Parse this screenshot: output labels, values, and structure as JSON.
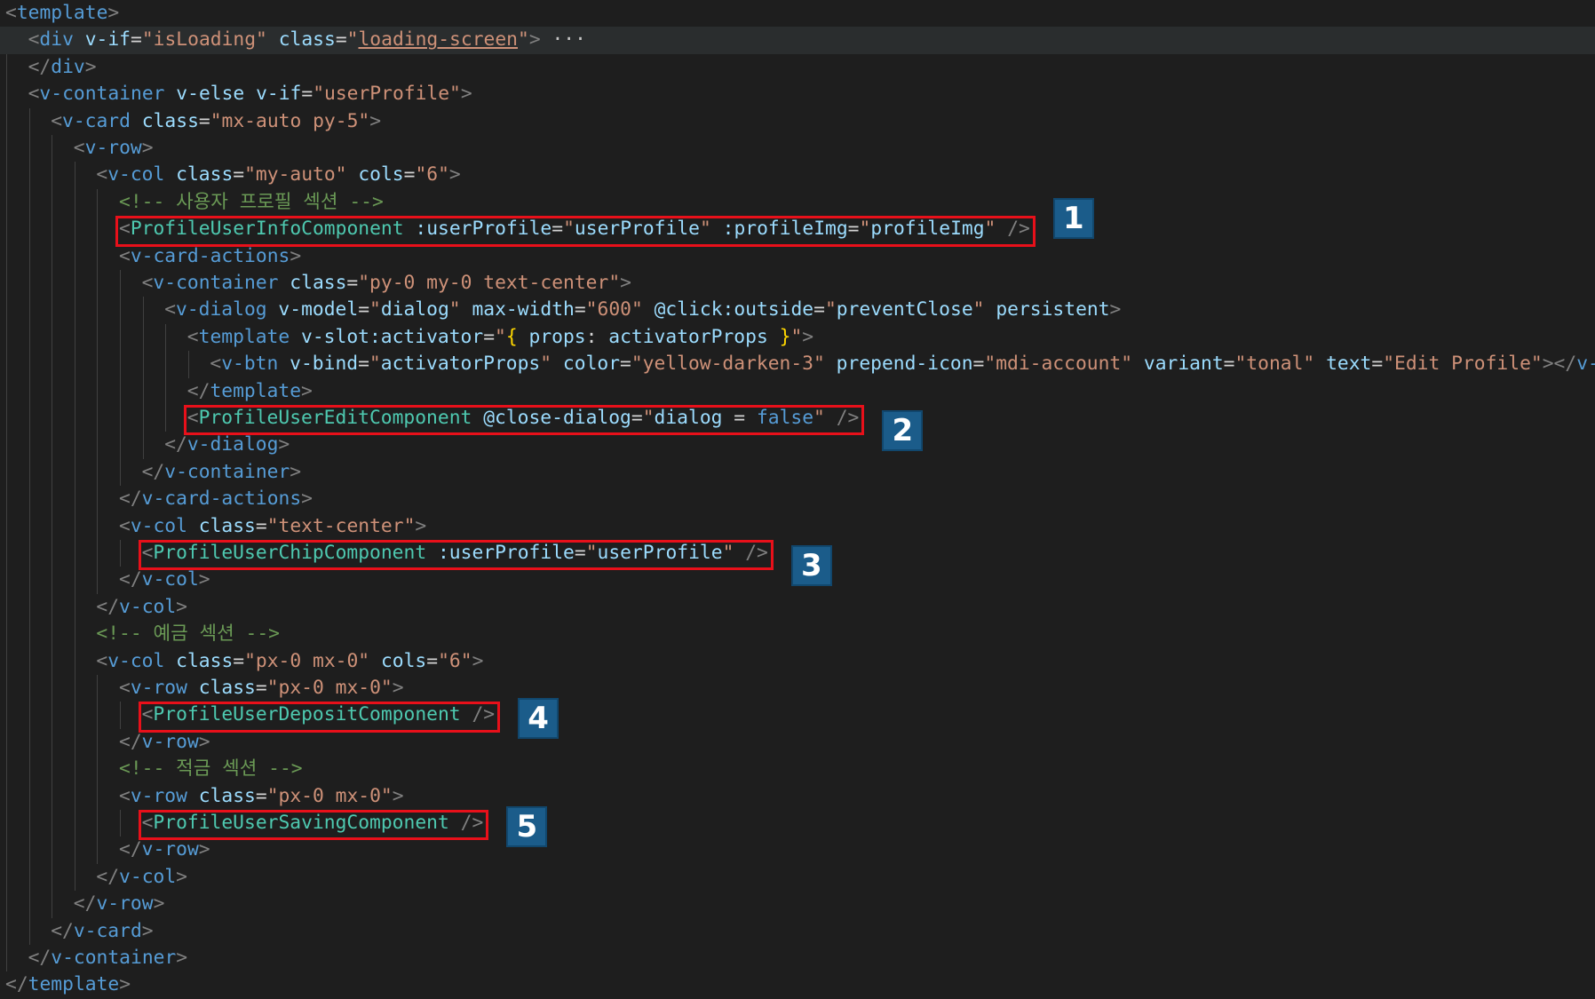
{
  "editor": {
    "theme_colors": {
      "background": "#1e1e1e",
      "tag": "#569cd6",
      "component": "#4ec9b0",
      "attribute": "#9cdcfe",
      "string": "#ce9178",
      "comment": "#6a9955",
      "punctuation": "#808080",
      "highlight_box": "#e8101a",
      "badge": "#1b5c8a"
    },
    "lines": [
      {
        "indent": 0,
        "tokens": [
          [
            "punc",
            "<"
          ],
          [
            "tag",
            "template"
          ],
          [
            "punc",
            ">"
          ]
        ]
      },
      {
        "indent": 1,
        "highlight": true,
        "tokens": [
          [
            "punc",
            "<"
          ],
          [
            "tag",
            "div"
          ],
          [
            "plain",
            " "
          ],
          [
            "attr",
            "v-if"
          ],
          [
            "eq",
            "="
          ],
          [
            "str",
            "\"isLoading\""
          ],
          [
            "plain",
            " "
          ],
          [
            "attr",
            "class"
          ],
          [
            "eq",
            "="
          ],
          [
            "str",
            "\""
          ],
          [
            "stru",
            "loading-screen"
          ],
          [
            "str",
            "\""
          ],
          [
            "punc",
            ">"
          ],
          [
            "fold",
            " ···"
          ]
        ]
      },
      {
        "indent": 1,
        "tokens": [
          [
            "punc",
            "</"
          ],
          [
            "tag",
            "div"
          ],
          [
            "punc",
            ">"
          ]
        ]
      },
      {
        "indent": 1,
        "tokens": [
          [
            "punc",
            "<"
          ],
          [
            "tag",
            "v-container"
          ],
          [
            "plain",
            " "
          ],
          [
            "attr",
            "v-else"
          ],
          [
            "plain",
            " "
          ],
          [
            "attr",
            "v-if"
          ],
          [
            "eq",
            "="
          ],
          [
            "str",
            "\"userProfile\""
          ],
          [
            "punc",
            ">"
          ]
        ]
      },
      {
        "indent": 2,
        "tokens": [
          [
            "punc",
            "<"
          ],
          [
            "tag",
            "v-card"
          ],
          [
            "plain",
            " "
          ],
          [
            "attr",
            "class"
          ],
          [
            "eq",
            "="
          ],
          [
            "str",
            "\"mx-auto py-5\""
          ],
          [
            "punc",
            ">"
          ]
        ]
      },
      {
        "indent": 3,
        "tokens": [
          [
            "punc",
            "<"
          ],
          [
            "tag",
            "v-row"
          ],
          [
            "punc",
            ">"
          ]
        ]
      },
      {
        "indent": 4,
        "tokens": [
          [
            "punc",
            "<"
          ],
          [
            "tag",
            "v-col"
          ],
          [
            "plain",
            " "
          ],
          [
            "attr",
            "class"
          ],
          [
            "eq",
            "="
          ],
          [
            "str",
            "\"my-auto\""
          ],
          [
            "plain",
            " "
          ],
          [
            "attr",
            "cols"
          ],
          [
            "eq",
            "="
          ],
          [
            "str",
            "\"6\""
          ],
          [
            "punc",
            ">"
          ]
        ]
      },
      {
        "indent": 5,
        "tokens": [
          [
            "comment",
            "<!-- 사용자 프로필 섹션 -->"
          ]
        ]
      },
      {
        "indent": 5,
        "tokens": [
          [
            "punc",
            "<"
          ],
          [
            "comp",
            "ProfileUserInfoComponent"
          ],
          [
            "plain",
            " "
          ],
          [
            "attr",
            ":userProfile"
          ],
          [
            "eq",
            "="
          ],
          [
            "str",
            "\""
          ],
          [
            "attr",
            "userProfile"
          ],
          [
            "str",
            "\""
          ],
          [
            "plain",
            " "
          ],
          [
            "attr",
            ":profileImg"
          ],
          [
            "eq",
            "="
          ],
          [
            "str",
            "\""
          ],
          [
            "attr",
            "profileImg"
          ],
          [
            "str",
            "\""
          ],
          [
            "plain",
            " "
          ],
          [
            "punc",
            "/>"
          ]
        ]
      },
      {
        "indent": 5,
        "tokens": [
          [
            "punc",
            "<"
          ],
          [
            "tag",
            "v-card-actions"
          ],
          [
            "punc",
            ">"
          ]
        ]
      },
      {
        "indent": 6,
        "tokens": [
          [
            "punc",
            "<"
          ],
          [
            "tag",
            "v-container"
          ],
          [
            "plain",
            " "
          ],
          [
            "attr",
            "class"
          ],
          [
            "eq",
            "="
          ],
          [
            "str",
            "\"py-0 my-0 text-center\""
          ],
          [
            "punc",
            ">"
          ]
        ]
      },
      {
        "indent": 7,
        "tokens": [
          [
            "punc",
            "<"
          ],
          [
            "tag",
            "v-dialog"
          ],
          [
            "plain",
            " "
          ],
          [
            "attr",
            "v-model"
          ],
          [
            "eq",
            "="
          ],
          [
            "str",
            "\""
          ],
          [
            "attr",
            "dialog"
          ],
          [
            "str",
            "\""
          ],
          [
            "plain",
            " "
          ],
          [
            "attr",
            "max-width"
          ],
          [
            "eq",
            "="
          ],
          [
            "str",
            "\"600\""
          ],
          [
            "plain",
            " "
          ],
          [
            "attr",
            "@click:outside"
          ],
          [
            "eq",
            "="
          ],
          [
            "str",
            "\""
          ],
          [
            "attr",
            "preventClose"
          ],
          [
            "str",
            "\""
          ],
          [
            "plain",
            " "
          ],
          [
            "attr",
            "persistent"
          ],
          [
            "punc",
            ">"
          ]
        ]
      },
      {
        "indent": 8,
        "tokens": [
          [
            "punc",
            "<"
          ],
          [
            "tag",
            "template"
          ],
          [
            "plain",
            " "
          ],
          [
            "attr",
            "v-slot:activator"
          ],
          [
            "eq",
            "="
          ],
          [
            "str",
            "\""
          ],
          [
            "brace",
            "{"
          ],
          [
            "plain",
            " "
          ],
          [
            "attr",
            "props"
          ],
          [
            "plain",
            ": "
          ],
          [
            "attr",
            "activatorProps"
          ],
          [
            "plain",
            " "
          ],
          [
            "brace",
            "}"
          ],
          [
            "str",
            "\""
          ],
          [
            "punc",
            ">"
          ]
        ]
      },
      {
        "indent": 9,
        "tokens": [
          [
            "punc",
            "<"
          ],
          [
            "tag",
            "v-btn"
          ],
          [
            "plain",
            " "
          ],
          [
            "attr",
            "v-bind"
          ],
          [
            "eq",
            "="
          ],
          [
            "str",
            "\""
          ],
          [
            "attr",
            "activatorProps"
          ],
          [
            "str",
            "\""
          ],
          [
            "plain",
            " "
          ],
          [
            "attr",
            "color"
          ],
          [
            "eq",
            "="
          ],
          [
            "str",
            "\"yellow-darken-3\""
          ],
          [
            "plain",
            " "
          ],
          [
            "attr",
            "prepend-icon"
          ],
          [
            "eq",
            "="
          ],
          [
            "str",
            "\"mdi-account\""
          ],
          [
            "plain",
            " "
          ],
          [
            "attr",
            "variant"
          ],
          [
            "eq",
            "="
          ],
          [
            "str",
            "\"tonal\""
          ],
          [
            "plain",
            " "
          ],
          [
            "attr",
            "text"
          ],
          [
            "eq",
            "="
          ],
          [
            "str",
            "\"Edit Profile\""
          ],
          [
            "punc",
            "></"
          ],
          [
            "tag",
            "v-btn"
          ],
          [
            "punc",
            ">"
          ]
        ]
      },
      {
        "indent": 8,
        "tokens": [
          [
            "punc",
            "</"
          ],
          [
            "tag",
            "template"
          ],
          [
            "punc",
            ">"
          ]
        ]
      },
      {
        "indent": 8,
        "tokens": [
          [
            "punc",
            "<"
          ],
          [
            "comp",
            "ProfileUserEditComponent"
          ],
          [
            "plain",
            " "
          ],
          [
            "attr",
            "@close-dialog"
          ],
          [
            "eq",
            "="
          ],
          [
            "str",
            "\""
          ],
          [
            "attr",
            "dialog"
          ],
          [
            "plain",
            " = "
          ],
          [
            "kw",
            "false"
          ],
          [
            "str",
            "\""
          ],
          [
            "plain",
            " "
          ],
          [
            "punc",
            "/>"
          ]
        ]
      },
      {
        "indent": 7,
        "tokens": [
          [
            "punc",
            "</"
          ],
          [
            "tag",
            "v-dialog"
          ],
          [
            "punc",
            ">"
          ]
        ]
      },
      {
        "indent": 6,
        "tokens": [
          [
            "punc",
            "</"
          ],
          [
            "tag",
            "v-container"
          ],
          [
            "punc",
            ">"
          ]
        ]
      },
      {
        "indent": 5,
        "tokens": [
          [
            "punc",
            "</"
          ],
          [
            "tag",
            "v-card-actions"
          ],
          [
            "punc",
            ">"
          ]
        ]
      },
      {
        "indent": 5,
        "tokens": [
          [
            "punc",
            "<"
          ],
          [
            "tag",
            "v-col"
          ],
          [
            "plain",
            " "
          ],
          [
            "attr",
            "class"
          ],
          [
            "eq",
            "="
          ],
          [
            "str",
            "\"text-center\""
          ],
          [
            "punc",
            ">"
          ]
        ]
      },
      {
        "indent": 6,
        "tokens": [
          [
            "punc",
            "<"
          ],
          [
            "comp",
            "ProfileUserChipComponent"
          ],
          [
            "plain",
            " "
          ],
          [
            "attr",
            ":userProfile"
          ],
          [
            "eq",
            "="
          ],
          [
            "str",
            "\""
          ],
          [
            "attr",
            "userProfile"
          ],
          [
            "str",
            "\""
          ],
          [
            "plain",
            " "
          ],
          [
            "punc",
            "/>"
          ]
        ]
      },
      {
        "indent": 5,
        "tokens": [
          [
            "punc",
            "</"
          ],
          [
            "tag",
            "v-col"
          ],
          [
            "punc",
            ">"
          ]
        ]
      },
      {
        "indent": 4,
        "tokens": [
          [
            "punc",
            "</"
          ],
          [
            "tag",
            "v-col"
          ],
          [
            "punc",
            ">"
          ]
        ]
      },
      {
        "indent": 4,
        "tokens": [
          [
            "comment",
            "<!-- 예금 섹션 -->"
          ]
        ]
      },
      {
        "indent": 4,
        "tokens": [
          [
            "punc",
            "<"
          ],
          [
            "tag",
            "v-col"
          ],
          [
            "plain",
            " "
          ],
          [
            "attr",
            "class"
          ],
          [
            "eq",
            "="
          ],
          [
            "str",
            "\"px-0 mx-0\""
          ],
          [
            "plain",
            " "
          ],
          [
            "attr",
            "cols"
          ],
          [
            "eq",
            "="
          ],
          [
            "str",
            "\"6\""
          ],
          [
            "punc",
            ">"
          ]
        ]
      },
      {
        "indent": 5,
        "tokens": [
          [
            "punc",
            "<"
          ],
          [
            "tag",
            "v-row"
          ],
          [
            "plain",
            " "
          ],
          [
            "attr",
            "class"
          ],
          [
            "eq",
            "="
          ],
          [
            "str",
            "\"px-0 mx-0\""
          ],
          [
            "punc",
            ">"
          ]
        ]
      },
      {
        "indent": 6,
        "tokens": [
          [
            "punc",
            "<"
          ],
          [
            "comp",
            "ProfileUserDepositComponent"
          ],
          [
            "plain",
            " "
          ],
          [
            "punc",
            "/>"
          ]
        ]
      },
      {
        "indent": 5,
        "tokens": [
          [
            "punc",
            "</"
          ],
          [
            "tag",
            "v-row"
          ],
          [
            "punc",
            ">"
          ]
        ]
      },
      {
        "indent": 5,
        "tokens": [
          [
            "comment",
            "<!-- 적금 섹션 -->"
          ]
        ]
      },
      {
        "indent": 5,
        "tokens": [
          [
            "punc",
            "<"
          ],
          [
            "tag",
            "v-row"
          ],
          [
            "plain",
            " "
          ],
          [
            "attr",
            "class"
          ],
          [
            "eq",
            "="
          ],
          [
            "str",
            "\"px-0 mx-0\""
          ],
          [
            "punc",
            ">"
          ]
        ]
      },
      {
        "indent": 6,
        "tokens": [
          [
            "punc",
            "<"
          ],
          [
            "comp",
            "ProfileUserSavingComponent"
          ],
          [
            "plain",
            " "
          ],
          [
            "punc",
            "/>"
          ]
        ]
      },
      {
        "indent": 5,
        "tokens": [
          [
            "punc",
            "</"
          ],
          [
            "tag",
            "v-row"
          ],
          [
            "punc",
            ">"
          ]
        ]
      },
      {
        "indent": 4,
        "tokens": [
          [
            "punc",
            "</"
          ],
          [
            "tag",
            "v-col"
          ],
          [
            "punc",
            ">"
          ]
        ]
      },
      {
        "indent": 3,
        "tokens": [
          [
            "punc",
            "</"
          ],
          [
            "tag",
            "v-row"
          ],
          [
            "punc",
            ">"
          ]
        ]
      },
      {
        "indent": 2,
        "tokens": [
          [
            "punc",
            "</"
          ],
          [
            "tag",
            "v-card"
          ],
          [
            "punc",
            ">"
          ]
        ]
      },
      {
        "indent": 1,
        "tokens": [
          [
            "punc",
            "</"
          ],
          [
            "tag",
            "v-container"
          ],
          [
            "punc",
            ">"
          ]
        ]
      },
      {
        "indent": 0,
        "tokens": [
          [
            "punc",
            "</"
          ],
          [
            "tag",
            "template"
          ],
          [
            "punc",
            ">"
          ]
        ]
      }
    ]
  },
  "annotations": [
    {
      "label": "1",
      "line": 8,
      "target": "ProfileUserInfoComponent"
    },
    {
      "label": "2",
      "line": 15,
      "target": "ProfileUserEditComponent"
    },
    {
      "label": "3",
      "line": 20,
      "target": "ProfileUserChipComponent"
    },
    {
      "label": "4",
      "line": 26,
      "target": "ProfileUserDepositComponent"
    },
    {
      "label": "5",
      "line": 30,
      "target": "ProfileUserSavingComponent"
    }
  ]
}
